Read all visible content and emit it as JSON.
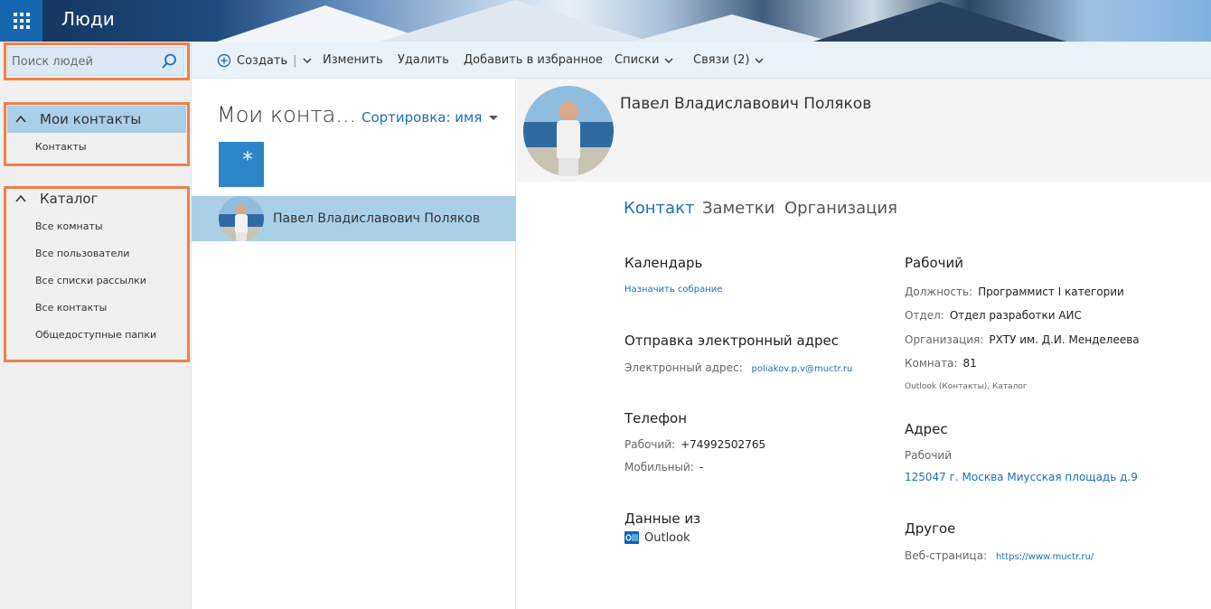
{
  "app": {
    "title": "Люди"
  },
  "search": {
    "placeholder": "Поиск людей"
  },
  "sidebar": {
    "my_contacts": {
      "label": "Мои контакты",
      "items": [
        "Контакты"
      ]
    },
    "catalog": {
      "label": "Каталог",
      "items": [
        "Все комнаты",
        "Все пользователи",
        "Все списки рассылки",
        "Все контакты",
        "Общедоступные папки"
      ]
    }
  },
  "annotations": [
    "1",
    "2",
    "3"
  ],
  "toolbar": {
    "create": "Создать",
    "edit": "Изменить",
    "delete": "Удалить",
    "favorite": "Добавить в избранное",
    "lists": "Списки",
    "links": "Связи (2)"
  },
  "list": {
    "title": "Мои конта...",
    "sort_label": "Сортировка: имя",
    "letter": "*",
    "contacts": [
      {
        "name": "Павел Владиславович Поляков"
      }
    ]
  },
  "detail": {
    "name": "Павел Владиславович Поляков",
    "tabs": [
      "Контакт",
      "Заметки",
      "Организация"
    ],
    "calendar": {
      "title": "Календарь",
      "action": "Назначить собрание"
    },
    "email": {
      "title": "Отправка электронный адрес",
      "label": "Электронный адрес:",
      "value": "poliakov.p.v@muctr.ru"
    },
    "phone": {
      "title": "Телефон",
      "work_label": "Рабочий:",
      "work_value": "+74992502765",
      "mobile_label": "Мобильный:",
      "mobile_value": "-"
    },
    "source": {
      "title": "Данные из",
      "value": "Outlook"
    },
    "work": {
      "title": "Рабочий",
      "position_label": "Должность:",
      "position_value": "Программист I категории",
      "dept_label": "Отдел:",
      "dept_value": "Отдел разработки АИС",
      "org_label": "Организация:",
      "org_value": "РХТУ им. Д.И. Менделеева",
      "room_label": "Комната:",
      "room_value": "81",
      "source_note": "Outlook (Контакты), Каталог"
    },
    "address": {
      "title": "Адрес",
      "type": "Рабочий",
      "value": "125047 г. Москва Миусская площадь д.9"
    },
    "other": {
      "title": "Другое",
      "web_label": "Веб-страница:",
      "web_value": "https://www.muctr.ru/"
    }
  },
  "colors": {
    "accent": "#1e6fb8",
    "selection": "#a9d0e6",
    "annotation": "#f0804a",
    "tile": "#2c86c8"
  }
}
